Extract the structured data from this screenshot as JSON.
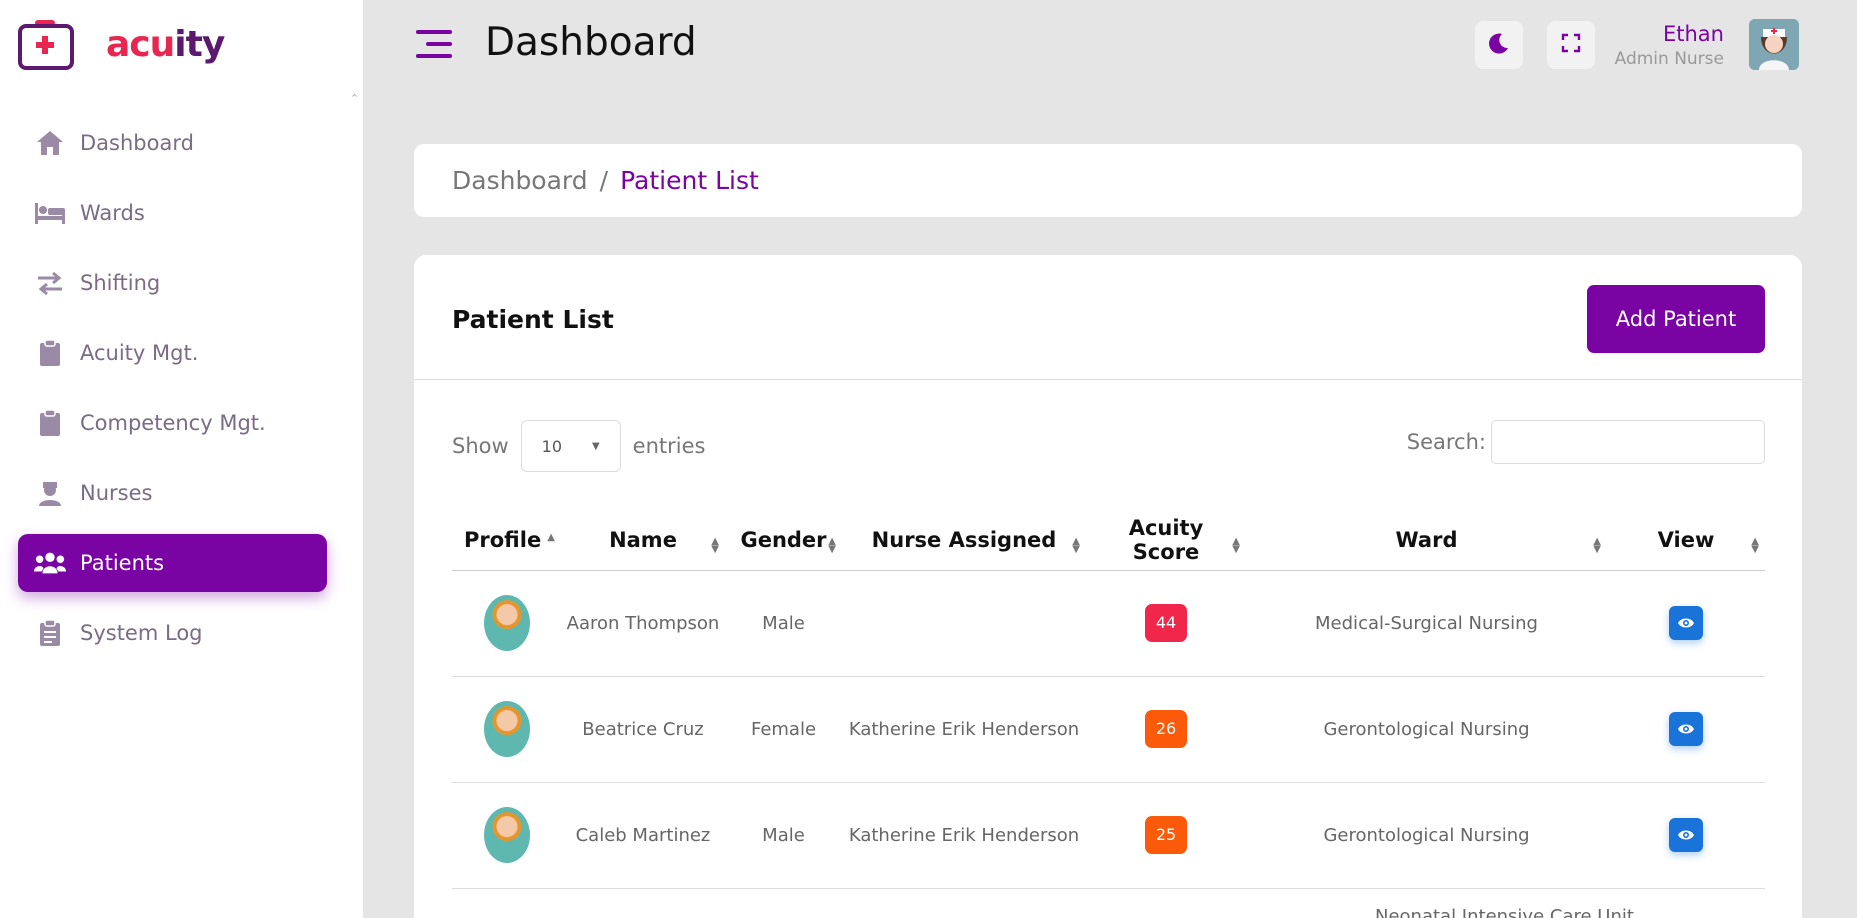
{
  "brand": {
    "name_part1": "acu",
    "name_part2": "ity",
    "accent": "#7a03a3",
    "red": "#e8264f"
  },
  "sidebar": {
    "items": [
      {
        "label": "Dashboard",
        "icon": "home-icon"
      },
      {
        "label": "Wards",
        "icon": "bed-icon"
      },
      {
        "label": "Shifting",
        "icon": "swap-icon"
      },
      {
        "label": "Acuity Mgt.",
        "icon": "clipboard-icon"
      },
      {
        "label": "Competency Mgt.",
        "icon": "clipboard-icon"
      },
      {
        "label": "Nurses",
        "icon": "nurse-icon"
      },
      {
        "label": "Patients",
        "icon": "users-icon",
        "active": true
      },
      {
        "label": "System Log",
        "icon": "clipboard-list-icon"
      }
    ]
  },
  "header": {
    "title": "Dashboard",
    "user_name": "Ethan",
    "user_role": "Admin Nurse"
  },
  "breadcrumb": {
    "root": "Dashboard",
    "separator": "/",
    "current": "Patient List"
  },
  "card": {
    "title": "Patient List",
    "add_button": "Add Patient",
    "show_label": "Show",
    "entries_value": "10",
    "entries_label": "entries",
    "search_label": "Search:"
  },
  "table": {
    "columns": [
      "Profile",
      "Name",
      "Gender",
      "Nurse Assigned",
      "Acuity Score",
      "Ward",
      "View"
    ],
    "rows": [
      {
        "name": "Aaron Thompson",
        "gender": "Male",
        "nurse": "",
        "score": "44",
        "score_color": "#f0264a",
        "ward": "Medical-Surgical Nursing"
      },
      {
        "name": "Beatrice Cruz",
        "gender": "Female",
        "nurse": "Katherine Erik Henderson",
        "score": "26",
        "score_color": "#fa5a0a",
        "ward": "Gerontological Nursing"
      },
      {
        "name": "Caleb Martinez",
        "gender": "Male",
        "nurse": "Katherine Erik Henderson",
        "score": "25",
        "score_color": "#fa5a0a",
        "ward": "Gerontological Nursing"
      }
    ],
    "partial_row_ward": "Neonatal Intensive Care Unit"
  }
}
